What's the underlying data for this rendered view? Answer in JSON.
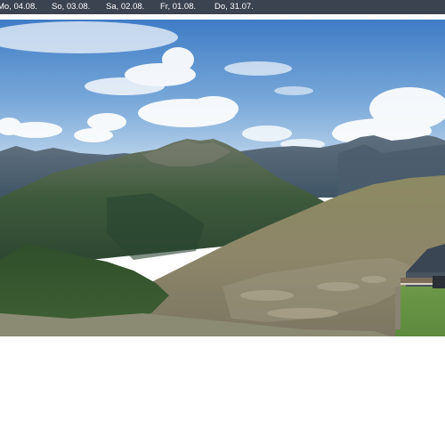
{
  "date_tabs": [
    {
      "label": "Mo, 04.08."
    },
    {
      "label": "So, 03.08."
    },
    {
      "label": "Sa, 02.08."
    },
    {
      "label": "Fr, 01.08."
    },
    {
      "label": "Do, 31.07."
    }
  ],
  "colors": {
    "datebar_bg": "#3b4250",
    "datebar_text": "#ffffff",
    "sky_top": "#3f7cc6",
    "sky_bottom": "#b9d3ea",
    "page_bg": "#ffffff"
  },
  "panorama": {
    "content": "webcam-mountain-panorama"
  }
}
